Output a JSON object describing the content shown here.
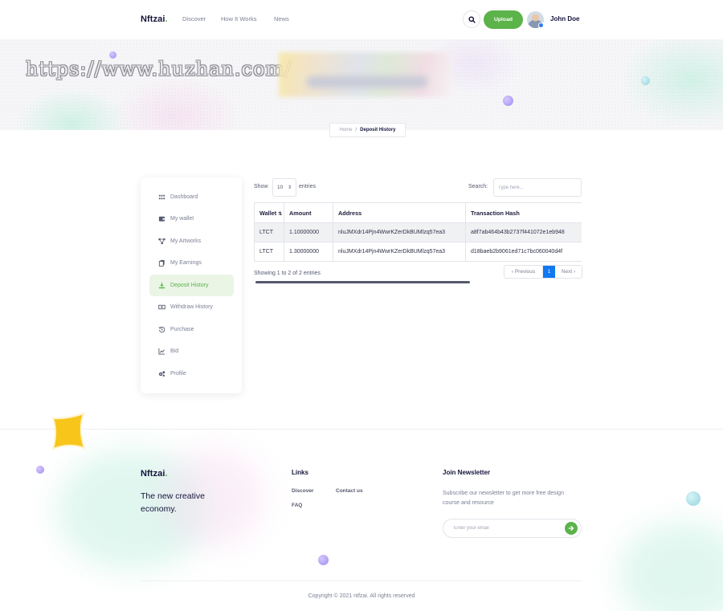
{
  "header": {
    "brand": "Nftzai",
    "brand_dot": ".",
    "nav": [
      "Discover",
      "How It Works",
      "News"
    ],
    "upload_label": "Upload",
    "user_name": "John Doe"
  },
  "hero": {
    "watermark": "https://www.huzhan.com/",
    "breadcrumb": {
      "home": "Home",
      "separator": "/",
      "current": "Deposit History"
    }
  },
  "sidebar": {
    "items": [
      {
        "label": "Dashboard",
        "icon": "grid-icon"
      },
      {
        "label": "My wallet",
        "icon": "wallet-icon"
      },
      {
        "label": "My Artworks",
        "icon": "nodes-icon"
      },
      {
        "label": "My Earnings",
        "icon": "copy-icon"
      },
      {
        "label": "Deposit History",
        "icon": "deposit-icon",
        "active": true
      },
      {
        "label": "Withdraw History",
        "icon": "cash-icon"
      },
      {
        "label": "Purchase",
        "icon": "history-icon"
      },
      {
        "label": "Bid",
        "icon": "chart-icon"
      },
      {
        "label": "Profile",
        "icon": "gears-icon"
      }
    ]
  },
  "table_controls": {
    "show_label": "Show",
    "page_length": "10",
    "entries_label": "entries",
    "search_label": "Search:",
    "search_placeholder": "Type here..."
  },
  "table": {
    "columns": [
      "Wallet",
      "Amount",
      "Address",
      "Transaction Hash"
    ],
    "rows": [
      [
        "LTCT",
        "1.10000000",
        "nluJMXdr14Pjn4WwrKZerDkBUMlzq57ea3",
        "a8f7ab464b43b2737f441072e1eb948"
      ],
      [
        "LTCT",
        "1.30000000",
        "nluJMXdr14Pjn4WwrKZerDkBUMlzq57ea3",
        "d18baeb2b9061ed71c7bc060040d4f"
      ]
    ],
    "info": "Showing 1 to 2 of 2 entries",
    "pagination": {
      "previous": "‹ Previous",
      "current_page": "1",
      "next": "Next ›"
    }
  },
  "footer": {
    "brand": "Nftzai",
    "brand_dot": ".",
    "tagline": "The new creative economy.",
    "links_heading": "Links",
    "links": [
      "Discover",
      "Contact us",
      "FAQ"
    ],
    "newsletter_heading": "Join Newsletter",
    "newsletter_text": "Subscribe our newsletter to get more free design course and resource",
    "email_placeholder": "Enter your email",
    "copyright": "Copyright © 2021 ntfzai. All rights reserved"
  },
  "colors": {
    "accent_green": "#5bb34a",
    "page_blue": "#1278f0",
    "text_dark": "#14143c",
    "text_muted": "#7b7f95"
  }
}
